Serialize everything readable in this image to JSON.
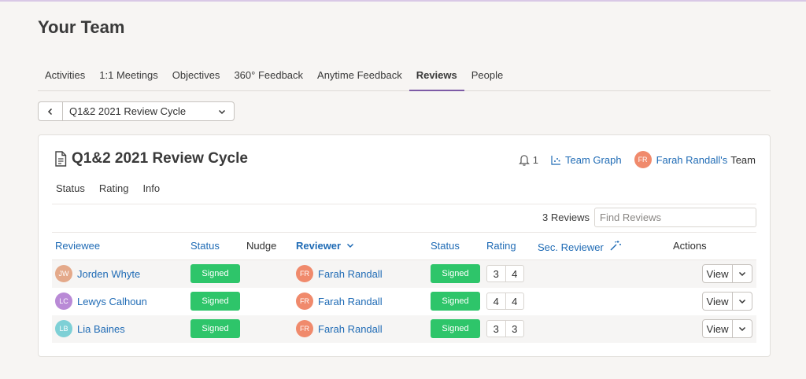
{
  "page": {
    "title": "Your Team"
  },
  "tabs": [
    {
      "label": "Activities"
    },
    {
      "label": "1:1 Meetings"
    },
    {
      "label": "Objectives"
    },
    {
      "label": "360° Feedback"
    },
    {
      "label": "Anytime Feedback"
    },
    {
      "label": "Reviews",
      "active": true
    },
    {
      "label": "People"
    }
  ],
  "cycle_selector": {
    "value": "Q1&2 2021 Review Cycle"
  },
  "card": {
    "title": "Q1&2 2021 Review Cycle",
    "notifications": "1",
    "team_graph": "Team Graph",
    "team_owner_initials": "FR",
    "team_owner": "Farah Randall's",
    "team_suffix": "Team",
    "subtabs": [
      "Status",
      "Rating",
      "Info"
    ],
    "count": "3 Reviews",
    "search_placeholder": "Find Reviews"
  },
  "table": {
    "headers": {
      "reviewee": "Reviewee",
      "status": "Status",
      "nudge": "Nudge",
      "reviewer": "Reviewer",
      "reviewer_status": "Status",
      "rating": "Rating",
      "sec_reviewer": "Sec. Reviewer",
      "actions": "Actions"
    },
    "rows": [
      {
        "initials": "JW",
        "avatar_color": "#e4a98a",
        "name": "Jorden Whyte",
        "status": "Signed",
        "reviewer_initials": "FR",
        "reviewer": "Farah Randall",
        "reviewer_status": "Signed",
        "rating_a": "3",
        "rating_b": "4",
        "action": "View"
      },
      {
        "initials": "LC",
        "avatar_color": "#b98ad6",
        "name": "Lewys Calhoun",
        "status": "Signed",
        "reviewer_initials": "FR",
        "reviewer": "Farah Randall",
        "reviewer_status": "Signed",
        "rating_a": "4",
        "rating_b": "4",
        "action": "View"
      },
      {
        "initials": "LB",
        "avatar_color": "#7ed0d6",
        "name": "Lia Baines",
        "status": "Signed",
        "reviewer_initials": "FR",
        "reviewer": "Farah Randall",
        "reviewer_status": "Signed",
        "rating_a": "3",
        "rating_b": "3",
        "action": "View"
      }
    ]
  },
  "colors": {
    "accent": "#7d5ba6",
    "link": "#1f6bb5",
    "signed": "#2ec56a",
    "reviewer_avatar": "#f08a6c"
  },
  "icons": [
    "chevron-left-icon",
    "chevron-down-icon",
    "document-icon",
    "bell-icon",
    "chart-icon",
    "magic-wand-icon"
  ]
}
